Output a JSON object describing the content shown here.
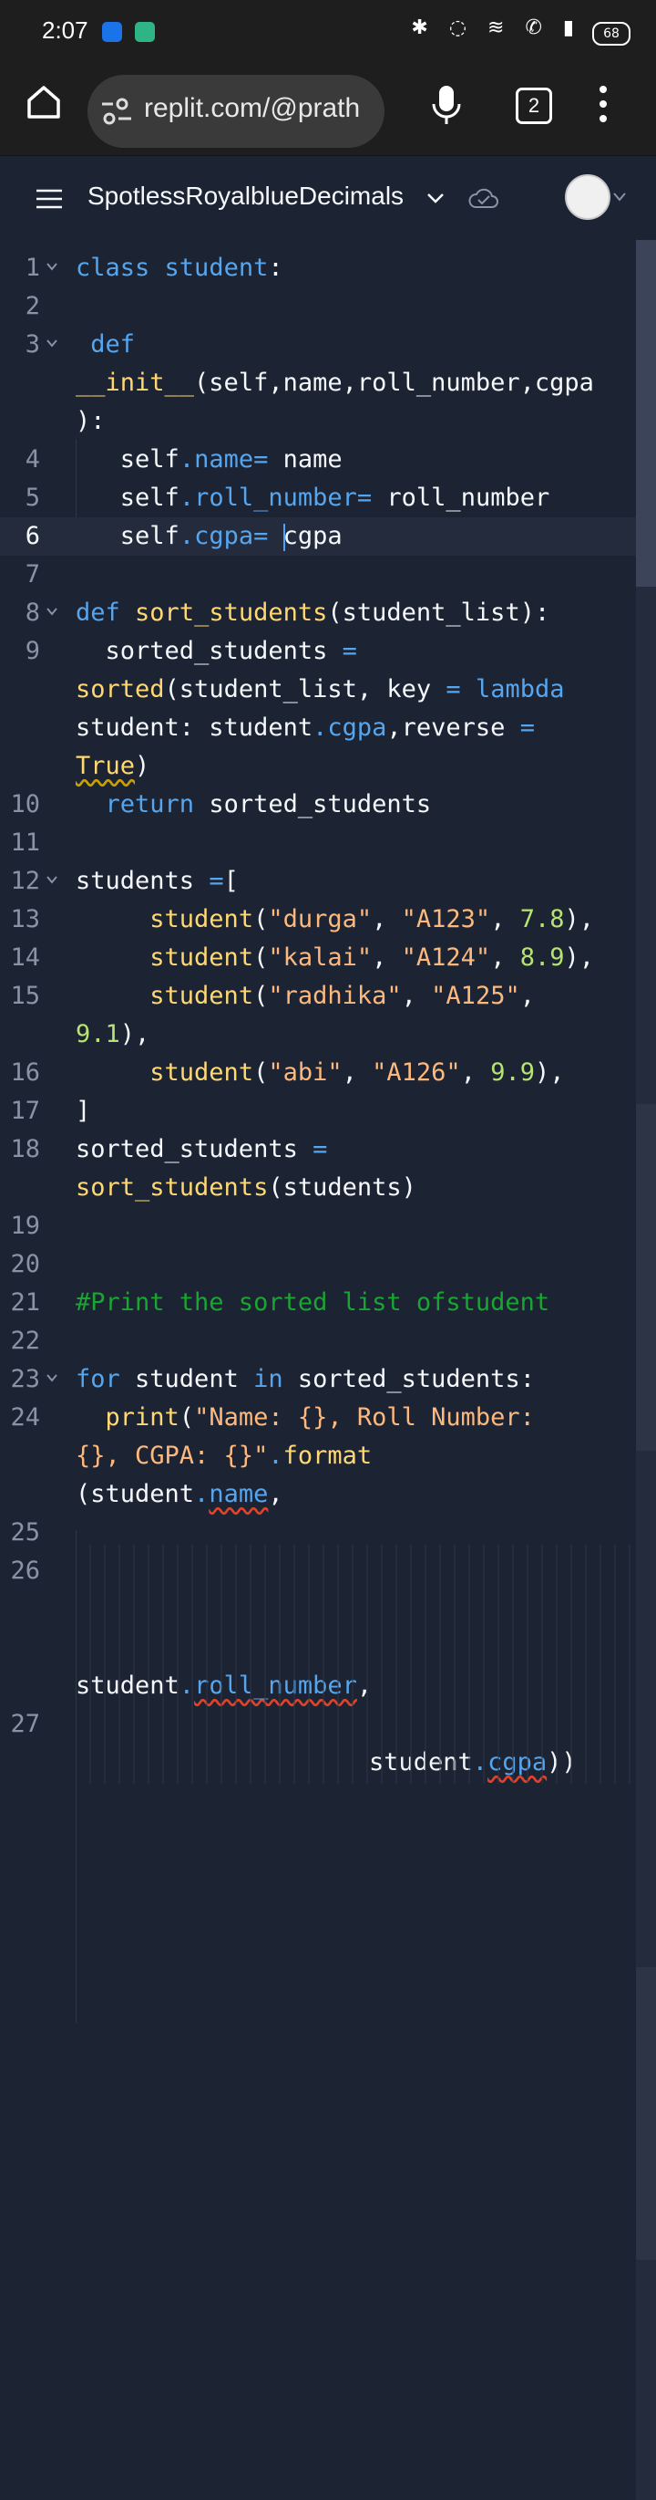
{
  "status_bar": {
    "time": "2:07",
    "battery": "68"
  },
  "browser": {
    "url": "replit.com/@prath",
    "tab_count": "2"
  },
  "replit": {
    "repl_name": "SpotlessRoyalblueDecimals"
  },
  "editor": {
    "lines": [
      {
        "n": "1"
      },
      {
        "n": "2"
      },
      {
        "n": "3"
      },
      {
        "n": ""
      },
      {
        "n": ""
      },
      {
        "n": "4"
      },
      {
        "n": "5"
      },
      {
        "n": "6"
      },
      {
        "n": "7"
      },
      {
        "n": "8"
      },
      {
        "n": "9"
      },
      {
        "n": ""
      },
      {
        "n": ""
      },
      {
        "n": ""
      },
      {
        "n": "10"
      },
      {
        "n": "11"
      },
      {
        "n": "12"
      },
      {
        "n": "13"
      },
      {
        "n": "14"
      },
      {
        "n": "15"
      },
      {
        "n": ""
      },
      {
        "n": "16"
      },
      {
        "n": "17"
      },
      {
        "n": "18"
      },
      {
        "n": ""
      },
      {
        "n": "19"
      },
      {
        "n": "20"
      },
      {
        "n": "21"
      },
      {
        "n": "22"
      },
      {
        "n": "23"
      },
      {
        "n": "24"
      },
      {
        "n": ""
      },
      {
        "n": ""
      },
      {
        "n": "25"
      },
      {
        "n": "26"
      },
      {
        "n": ""
      },
      {
        "n": ""
      },
      {
        "n": ""
      },
      {
        "n": ""
      },
      {
        "n": "27"
      }
    ],
    "code": {
      "l1_kw": "class",
      "l1_name": "student",
      "l1_colon": ":",
      "l3_kw": "def",
      "l3b_name": "__init__",
      "l3b_args": "(self,name,roll_number,cgpa",
      "l3c": "):",
      "l4_self": "self",
      "l4_dot": ".",
      "l4_attr": "name",
      "l4_eq": "=",
      "l4_val": " name",
      "l5_self": "self",
      "l5_dot": ".",
      "l5_attr": "roll_number",
      "l5_eq": "=",
      "l5_val": " roll_number",
      "l6_self": "self",
      "l6_dot": ".",
      "l6_attr": "cgpa",
      "l6_eq": "=",
      "l6_val": "cgpa",
      "l8_kw": "def",
      "l8_name": "sort_students",
      "l8_args": "(student_list):",
      "l9a_var": "sorted_students",
      "l9a_eq": "=",
      "l9b_fn": "sorted",
      "l9b_args": "(student_list, key ",
      "l9b_eq": "=",
      "l9b_kw": "lambda",
      "l9c_a": "student: student",
      "l9c_dot": ".",
      "l9c_attr": "cgpa",
      "l9c_b": ",reverse ",
      "l9c_eq": "=",
      "l9d_true": "True",
      "l9d_paren": ")",
      "l10_kw": "return",
      "l10_val": "sorted_students",
      "l12_var": "students ",
      "l12_eq": "=",
      "l12_br": "[",
      "l13_fn": "student",
      "l13_s1": "\"durga\"",
      "l13_s2": "\"A123\"",
      "l13_n": "7.8",
      "l14_fn": "student",
      "l14_s1": "\"kalai\"",
      "l14_s2": "\"A124\"",
      "l14_n": "8.9",
      "l15_fn": "student",
      "l15_s1": "\"radhika\"",
      "l15_s2": "\"A125\"",
      "l15b_n": "9.1",
      "l15b_end": "),",
      "l16_fn": "student",
      "l16_s1": "\"abi\"",
      "l16_s2": "\"A126\"",
      "l16_n": "9.9",
      "l17": "]",
      "l18a_var": "sorted_students",
      "l18a_eq": "=",
      "l18b_fn": "sort_students",
      "l18b_args": "(students)",
      "l21_comment": "#Print the sorted list ofstudent",
      "l23_kw1": "for",
      "l23_var": " student ",
      "l23_kw2": "in",
      "l23_rest": " sorted_students:",
      "l24a_fn": "print",
      "l24a_paren": "(",
      "l24a_str": "\"Name: {}, Roll Number:",
      "l24b_str": "{}, CGPA: {}\"",
      "l24b_dot": ".",
      "l24b_fn": "format",
      "l24c_a": "(student",
      "l24c_dot": ".",
      "l24c_attr": "name",
      "l24c_b": ",",
      "l26_a": "student",
      "l26_dot": ".",
      "l26_attr": "roll_number",
      "l26_b": ",",
      "l27_a": "student",
      "l27_dot": ".",
      "l27_attr": "cgpa",
      "l27_b": "))"
    }
  }
}
